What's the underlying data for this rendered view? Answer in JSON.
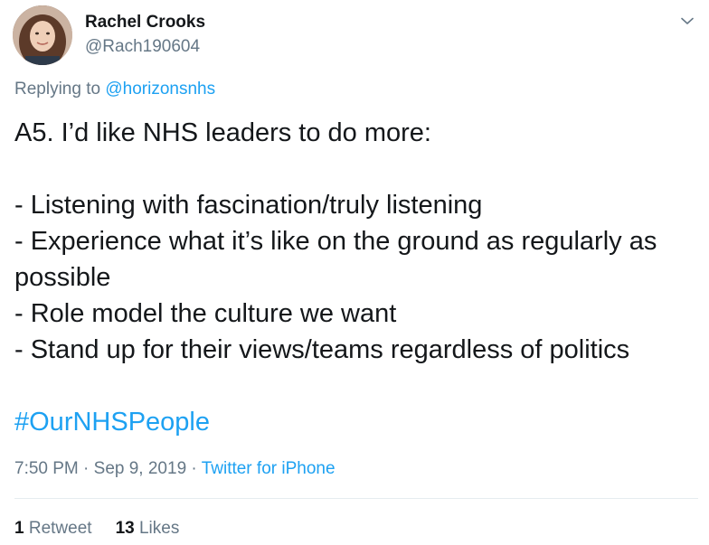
{
  "author": {
    "display_name": "Rachel Crooks",
    "handle": "@Rach190604"
  },
  "reply": {
    "prefix": "Replying to ",
    "mention": "@horizonsnhs"
  },
  "tweet": {
    "lines": [
      "A5.  I’d like NHS leaders to do more:",
      "",
      "- Listening with fascination/truly listening",
      "- Experience what it’s like on the ground as regularly as",
      "possible",
      "- Role model the culture we want",
      "- Stand up for their views/teams regardless of politics",
      ""
    ],
    "hashtag": "#OurNHSPeople"
  },
  "meta": {
    "time": "7:50 PM",
    "separator1": " · ",
    "date": "Sep 9, 2019",
    "separator2": " · ",
    "source": "Twitter for iPhone"
  },
  "stats": {
    "retweets_count": "1",
    "retweets_label": "Retweet",
    "likes_count": "13",
    "likes_label": "Likes"
  },
  "icons": {
    "more": "chevron-down-icon"
  },
  "colors": {
    "link": "#1da1f2",
    "secondary": "#657786",
    "primary_text": "#14171a",
    "divider": "#e6ecf0"
  }
}
